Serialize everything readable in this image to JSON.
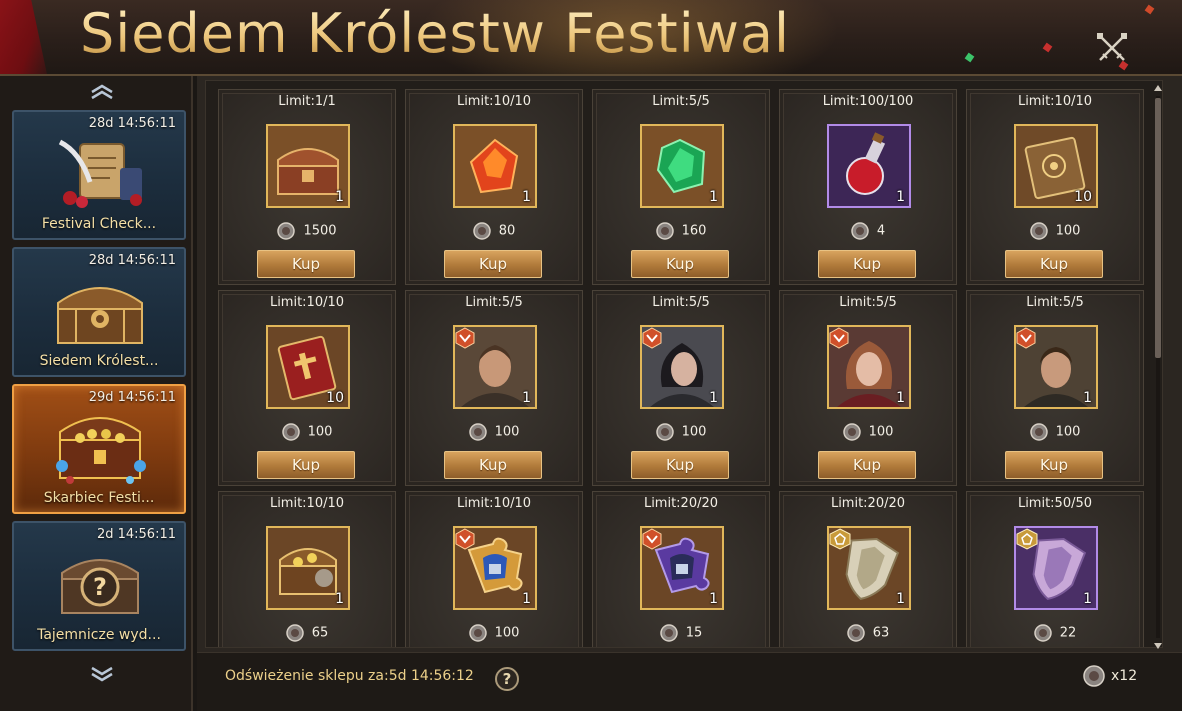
{
  "header": {
    "title": "Siedem Królestw Festiwal"
  },
  "sidebar": {
    "items": [
      {
        "timer": "28d 14:56:11",
        "label": "Festival Check...",
        "icon": "scroll-quill-icon",
        "active": false
      },
      {
        "timer": "28d 14:56:11",
        "label": "Siedem Królest...",
        "icon": "golden-chest-icon",
        "active": false
      },
      {
        "timer": "29d 14:56:11",
        "label": "Skarbiec Festi...",
        "icon": "treasure-chest-icon",
        "active": true
      },
      {
        "timer": "2d 14:56:11",
        "label": "Tajemnicze wyd...",
        "icon": "mystery-chest-icon",
        "active": false
      }
    ]
  },
  "shop": {
    "buy_label": "Kup",
    "items": [
      {
        "limit": "Limit:1/1",
        "qty": "1",
        "price": "1500",
        "icon": "chest-icon",
        "frame": "gold"
      },
      {
        "limit": "Limit:10/10",
        "qty": "1",
        "price": "80",
        "icon": "fire-gem-icon",
        "frame": "gold"
      },
      {
        "limit": "Limit:5/5",
        "qty": "1",
        "price": "160",
        "icon": "emerald-gem-icon",
        "frame": "gold"
      },
      {
        "limit": "Limit:100/100",
        "qty": "1",
        "price": "4",
        "icon": "potion-icon",
        "frame": "purple"
      },
      {
        "limit": "Limit:10/10",
        "qty": "10",
        "price": "100",
        "icon": "tome-icon",
        "frame": "gold"
      },
      {
        "limit": "Limit:10/10",
        "qty": "10",
        "price": "100",
        "icon": "red-book-icon",
        "frame": "gold"
      },
      {
        "limit": "Limit:5/5",
        "qty": "1",
        "price": "100",
        "icon": "hero-portrait-icon",
        "frame": "gold"
      },
      {
        "limit": "Limit:5/5",
        "qty": "1",
        "price": "100",
        "icon": "hero-portrait-icon",
        "frame": "gold"
      },
      {
        "limit": "Limit:5/5",
        "qty": "1",
        "price": "100",
        "icon": "hero-portrait-icon",
        "frame": "gold"
      },
      {
        "limit": "Limit:5/5",
        "qty": "1",
        "price": "100",
        "icon": "hero-portrait-icon",
        "frame": "gold"
      },
      {
        "limit": "Limit:10/10",
        "qty": "1",
        "price": "65",
        "icon": "treasure-icon",
        "frame": "gold"
      },
      {
        "limit": "Limit:10/10",
        "qty": "1",
        "price": "100",
        "icon": "puzzle-piece-icon",
        "frame": "gold"
      },
      {
        "limit": "Limit:20/20",
        "qty": "1",
        "price": "15",
        "icon": "puzzle-piece-icon",
        "frame": "gold"
      },
      {
        "limit": "Limit:20/20",
        "qty": "1",
        "price": "63",
        "icon": "shield-icon",
        "frame": "gold"
      },
      {
        "limit": "Limit:50/50",
        "qty": "1",
        "price": "22",
        "icon": "shield-icon",
        "frame": "purple"
      }
    ]
  },
  "footer": {
    "refresh": "Odświeżenie sklepu za:5d 14:56:12",
    "help": "?",
    "balance": "x12"
  },
  "colors": {
    "accent_gold": "#e1b75a",
    "button": "#c08a48",
    "active_tab": "#a14f16"
  }
}
